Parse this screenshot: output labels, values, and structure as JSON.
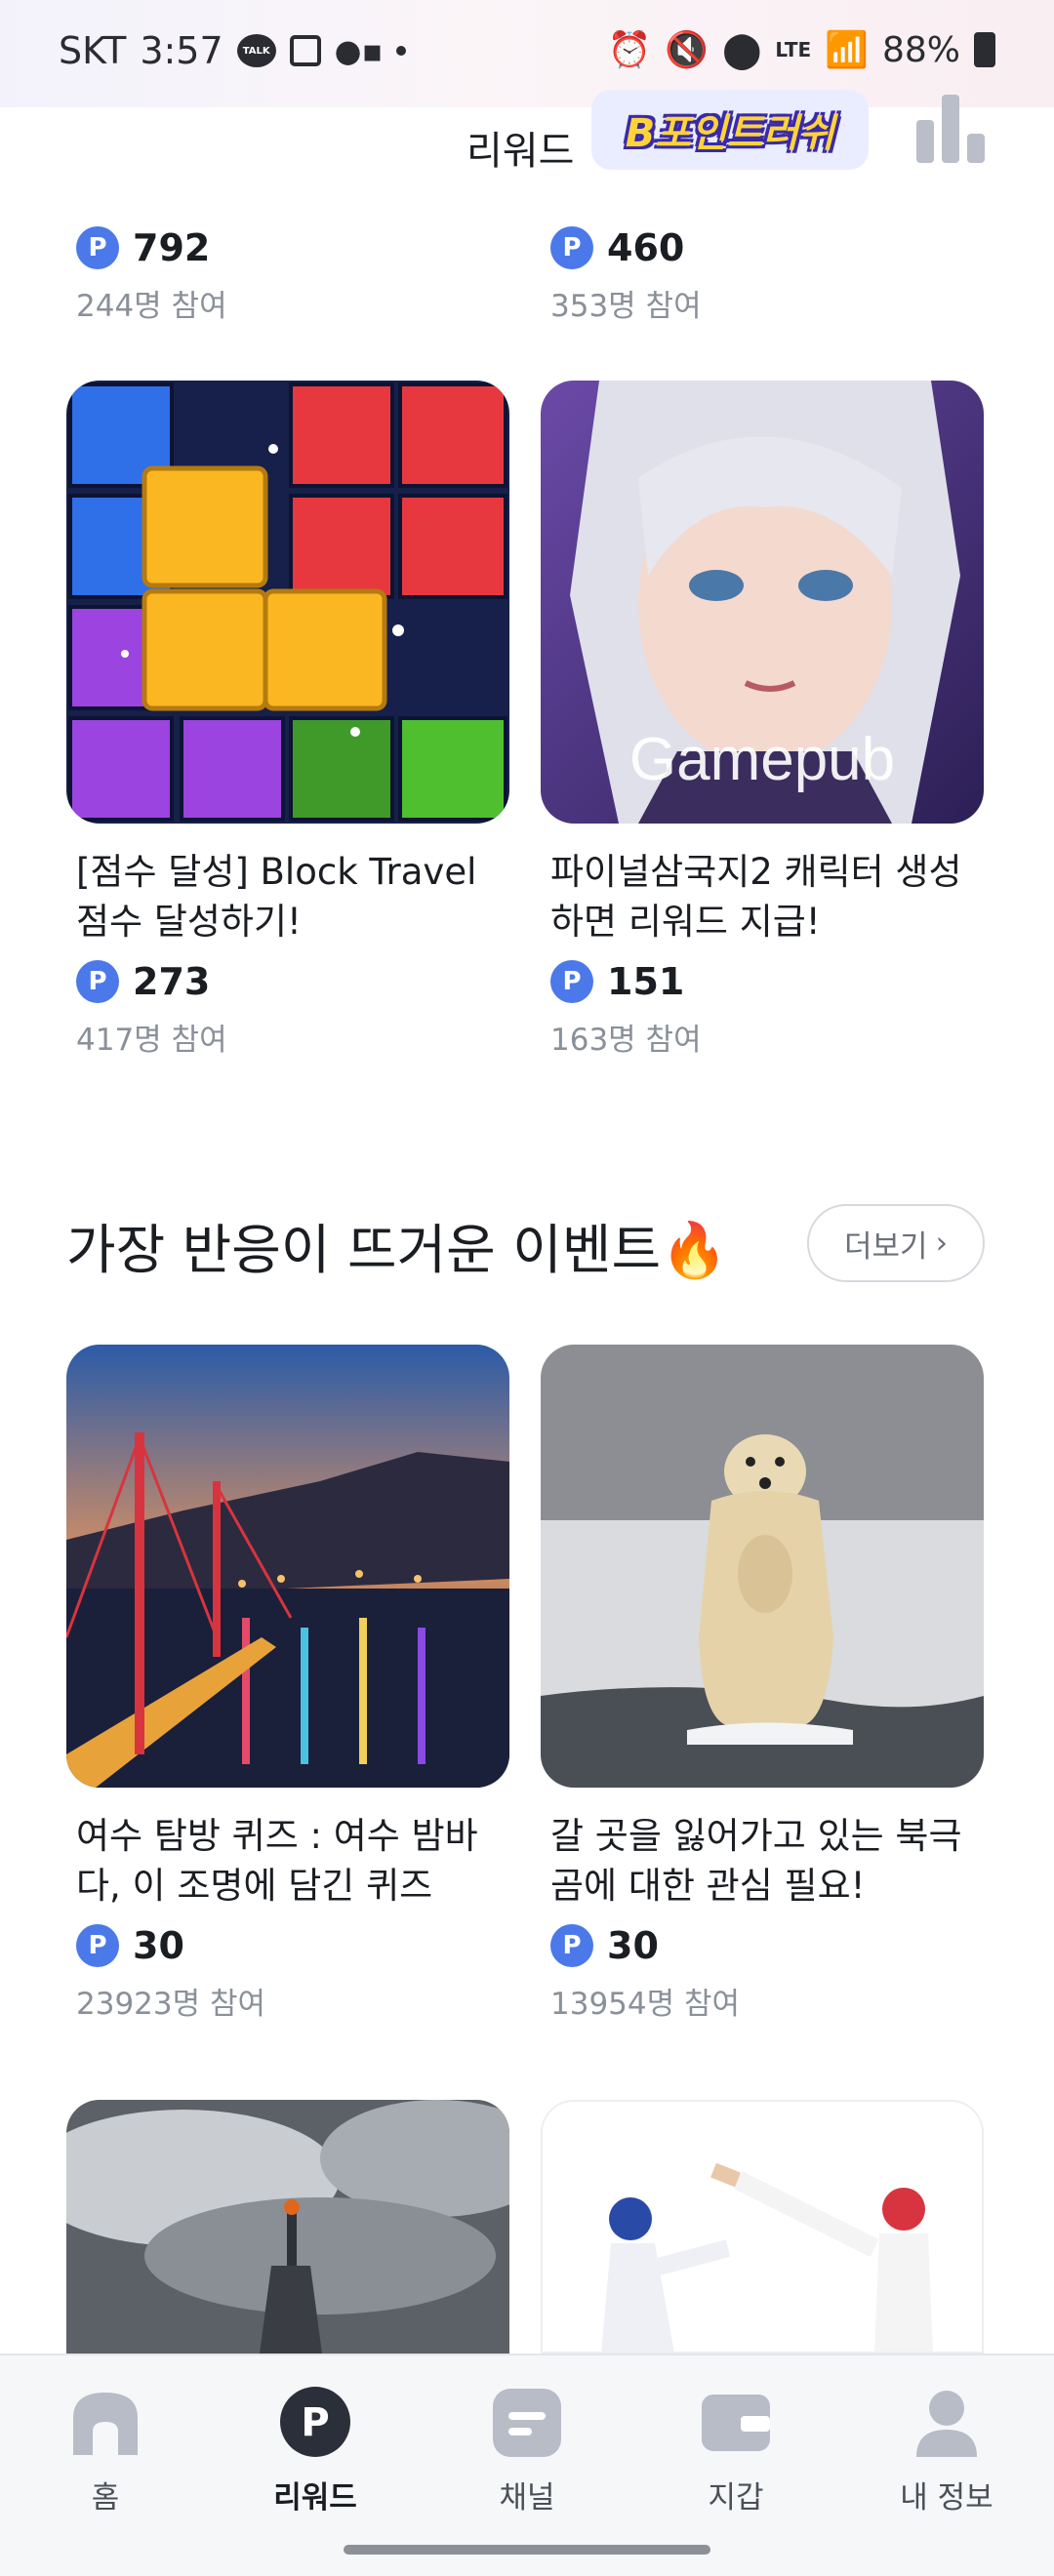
{
  "status_bar": {
    "carrier": "SKT",
    "time": "3:57",
    "talk_badge": "TALK",
    "network": "LTE",
    "battery": "88%"
  },
  "header": {
    "title": "리워드",
    "banner_text": "B포인트러쉬"
  },
  "top_partial": [
    {
      "points": "792",
      "participants": "244명 참여"
    },
    {
      "points": "460",
      "participants": "353명 참여"
    }
  ],
  "game_cards": [
    {
      "title": "[점수 달성] Block Travel 점수 달성하기!",
      "points": "273",
      "participants": "417명 참여",
      "image": "block-puzzle-image"
    },
    {
      "title": "파이널삼국지2 캐릭터 생성하면 리워드 지급!",
      "points": "151",
      "participants": "163명 참여",
      "image": "gamepub-character-image",
      "watermark": "Gamepub"
    }
  ],
  "hot_section": {
    "title": "가장 반응이 뜨거운 이벤트",
    "emoji": "🔥",
    "more_label": "더보기",
    "more_icon": "chevron-right-icon"
  },
  "event_cards": [
    {
      "title": "여수 탐방 퀴즈 : 여수 밤바다, 이 조명에 담긴 퀴즈",
      "points": "30",
      "participants": "23923명 참여",
      "image": "yeosu-night-bridge-image"
    },
    {
      "title": "갈 곳을 잃어가고 있는 북극곰에 대한 관심 필요!",
      "points": "30",
      "participants": "13954명 참여",
      "image": "polar-bear-image"
    }
  ],
  "point_symbol": "P",
  "bottom_nav": [
    {
      "label": "홈",
      "icon": "home-icon"
    },
    {
      "label": "리워드",
      "icon": "reward-p-icon",
      "active": true
    },
    {
      "label": "채널",
      "icon": "channel-icon"
    },
    {
      "label": "지갑",
      "icon": "wallet-icon"
    },
    {
      "label": "내 정보",
      "icon": "profile-icon"
    }
  ],
  "colors": {
    "point_blue": "#4b79ea",
    "nav_bg": "#f6f7f9",
    "muted_text": "#8a9099"
  }
}
